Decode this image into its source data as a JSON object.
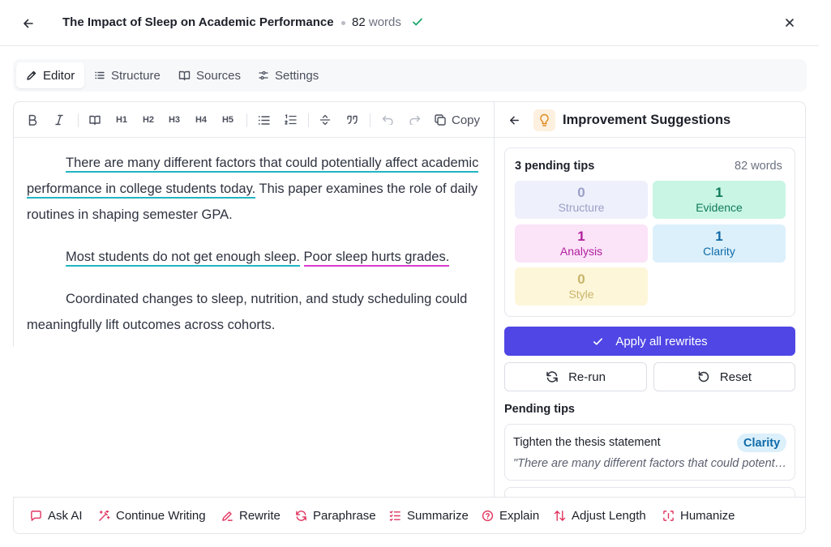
{
  "header": {
    "title": "The Impact of Sleep on Academic Performance",
    "word_count": "82",
    "word_unit": "words"
  },
  "tabs": [
    {
      "label": "Editor",
      "icon": "pencil-icon",
      "active": true
    },
    {
      "label": "Structure",
      "icon": "list-icon"
    },
    {
      "label": "Sources",
      "icon": "book-icon"
    },
    {
      "label": "Settings",
      "icon": "sliders-icon"
    }
  ],
  "toolbar": {
    "headings": [
      "H1",
      "H2",
      "H3",
      "H4",
      "H5"
    ],
    "copy_label": "Copy"
  },
  "editor": {
    "p1_flagged": "There are many different factors that could potentially affect academic performance in college students today.",
    "p1_rest": " This paper examines the role of daily routines in shaping semester GPA.",
    "p2_flagged_a": "Most students do not get enough sleep.",
    "p2_flagged_b": "Poor sleep hurts grades.",
    "p3": "Coordinated changes to sleep, nutrition, and study scheduling could meaningfully lift outcomes across cohorts."
  },
  "suggestions": {
    "title": "Improvement Suggestions",
    "pending_count": "3 pending tips",
    "word_count": "82 words",
    "categories": [
      {
        "count": "0",
        "label": "Structure",
        "bg": "#eef0fb",
        "fg": "#9aa0c8"
      },
      {
        "count": "1",
        "label": "Evidence",
        "bg": "#c8f5e4",
        "fg": "#0f7a5a"
      },
      {
        "count": "1",
        "label": "Analysis",
        "bg": "#fbe3f8",
        "fg": "#b0209e"
      },
      {
        "count": "1",
        "label": "Clarity",
        "bg": "#dcf0fb",
        "fg": "#0e6aa8"
      },
      {
        "count": "0",
        "label": "Style",
        "bg": "#fdf6d9",
        "fg": "#c9b56a"
      }
    ],
    "apply_label": "Apply all rewrites",
    "rerun_label": "Re-run",
    "reset_label": "Reset",
    "pending_heading": "Pending tips",
    "tips": [
      {
        "title": "Tighten the thesis statement",
        "badge": "Clarity",
        "quote": "\"There are many different factors that could potentially affect academic performance in college students today.\""
      }
    ]
  },
  "ai_actions": [
    {
      "label": "Ask AI",
      "icon": "chat-icon"
    },
    {
      "label": "Continue Writing",
      "icon": "magic-wand-icon"
    },
    {
      "label": "Rewrite",
      "icon": "pen-icon"
    },
    {
      "label": "Paraphrase",
      "icon": "refresh-icon"
    },
    {
      "label": "Summarize",
      "icon": "list-check-icon"
    },
    {
      "label": "Explain",
      "icon": "help-circle-icon"
    },
    {
      "label": "Adjust Length",
      "icon": "arrows-up-down-icon"
    },
    {
      "label": "Humanize",
      "icon": "scan-icon"
    }
  ],
  "colors": {
    "accent": "#4f46e5",
    "ai_icon": "#e0355f"
  }
}
